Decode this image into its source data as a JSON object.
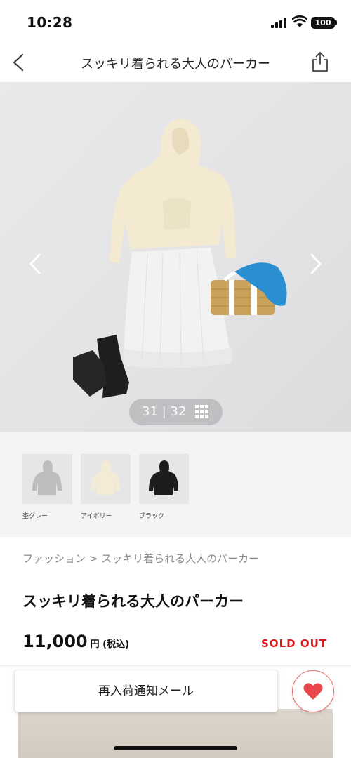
{
  "status_bar": {
    "time": "10:28",
    "battery": "100"
  },
  "header": {
    "title": "スッキリ着られる大人のパーカー",
    "back_icon": "chevron-left-icon",
    "share_icon": "share-icon"
  },
  "gallery": {
    "counter": "31 | 32",
    "current": 31,
    "total": 32,
    "background": "#e6e6e8"
  },
  "swatches": [
    {
      "label": "杢グレー",
      "color": "#bdbdbd"
    },
    {
      "label": "アイボリー",
      "color": "#f3ebd6"
    },
    {
      "label": "ブラック",
      "color": "#1c1c1c"
    }
  ],
  "breadcrumb": "ファッション > スッキリ着られる大人のパーカー",
  "product": {
    "title": "スッキリ着られる大人のパーカー",
    "price": "11,000",
    "price_unit": "円 (税込)",
    "status": "SOLD OUT"
  },
  "actions": {
    "notify_label": "再入荷通知メール",
    "favorite_icon": "heart-icon"
  },
  "colors": {
    "sold_out": "#e3141c",
    "heart": "#e8474c"
  }
}
